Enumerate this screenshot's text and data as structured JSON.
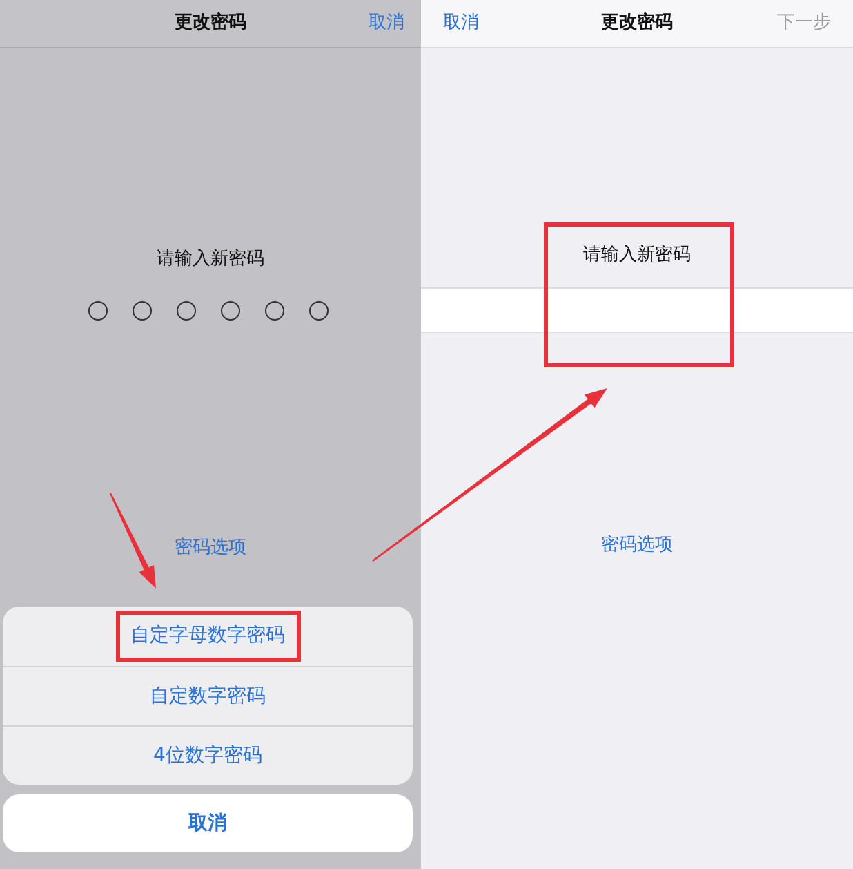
{
  "left_screen": {
    "nav_title": "更改密码",
    "nav_cancel": "取消",
    "prompt": "请输入新密码",
    "passcode_digits": [
      {
        "filled": false
      },
      {
        "filled": false
      },
      {
        "filled": false
      },
      {
        "filled": false
      },
      {
        "filled": false
      },
      {
        "filled": false
      }
    ],
    "options_link": "密码选项",
    "action_sheet": {
      "options": [
        {
          "label": "自定字母数字密码",
          "highlighted": true
        },
        {
          "label": "自定数字密码",
          "highlighted": false
        },
        {
          "label": "4位数字密码",
          "highlighted": false
        }
      ],
      "cancel": "取消"
    }
  },
  "right_screen": {
    "nav_cancel": "取消",
    "nav_title": "更改密码",
    "nav_next": "下一步",
    "next_disabled": true,
    "prompt": "请输入新密码",
    "prompt_highlighted": true,
    "options_link": "密码选项"
  }
}
